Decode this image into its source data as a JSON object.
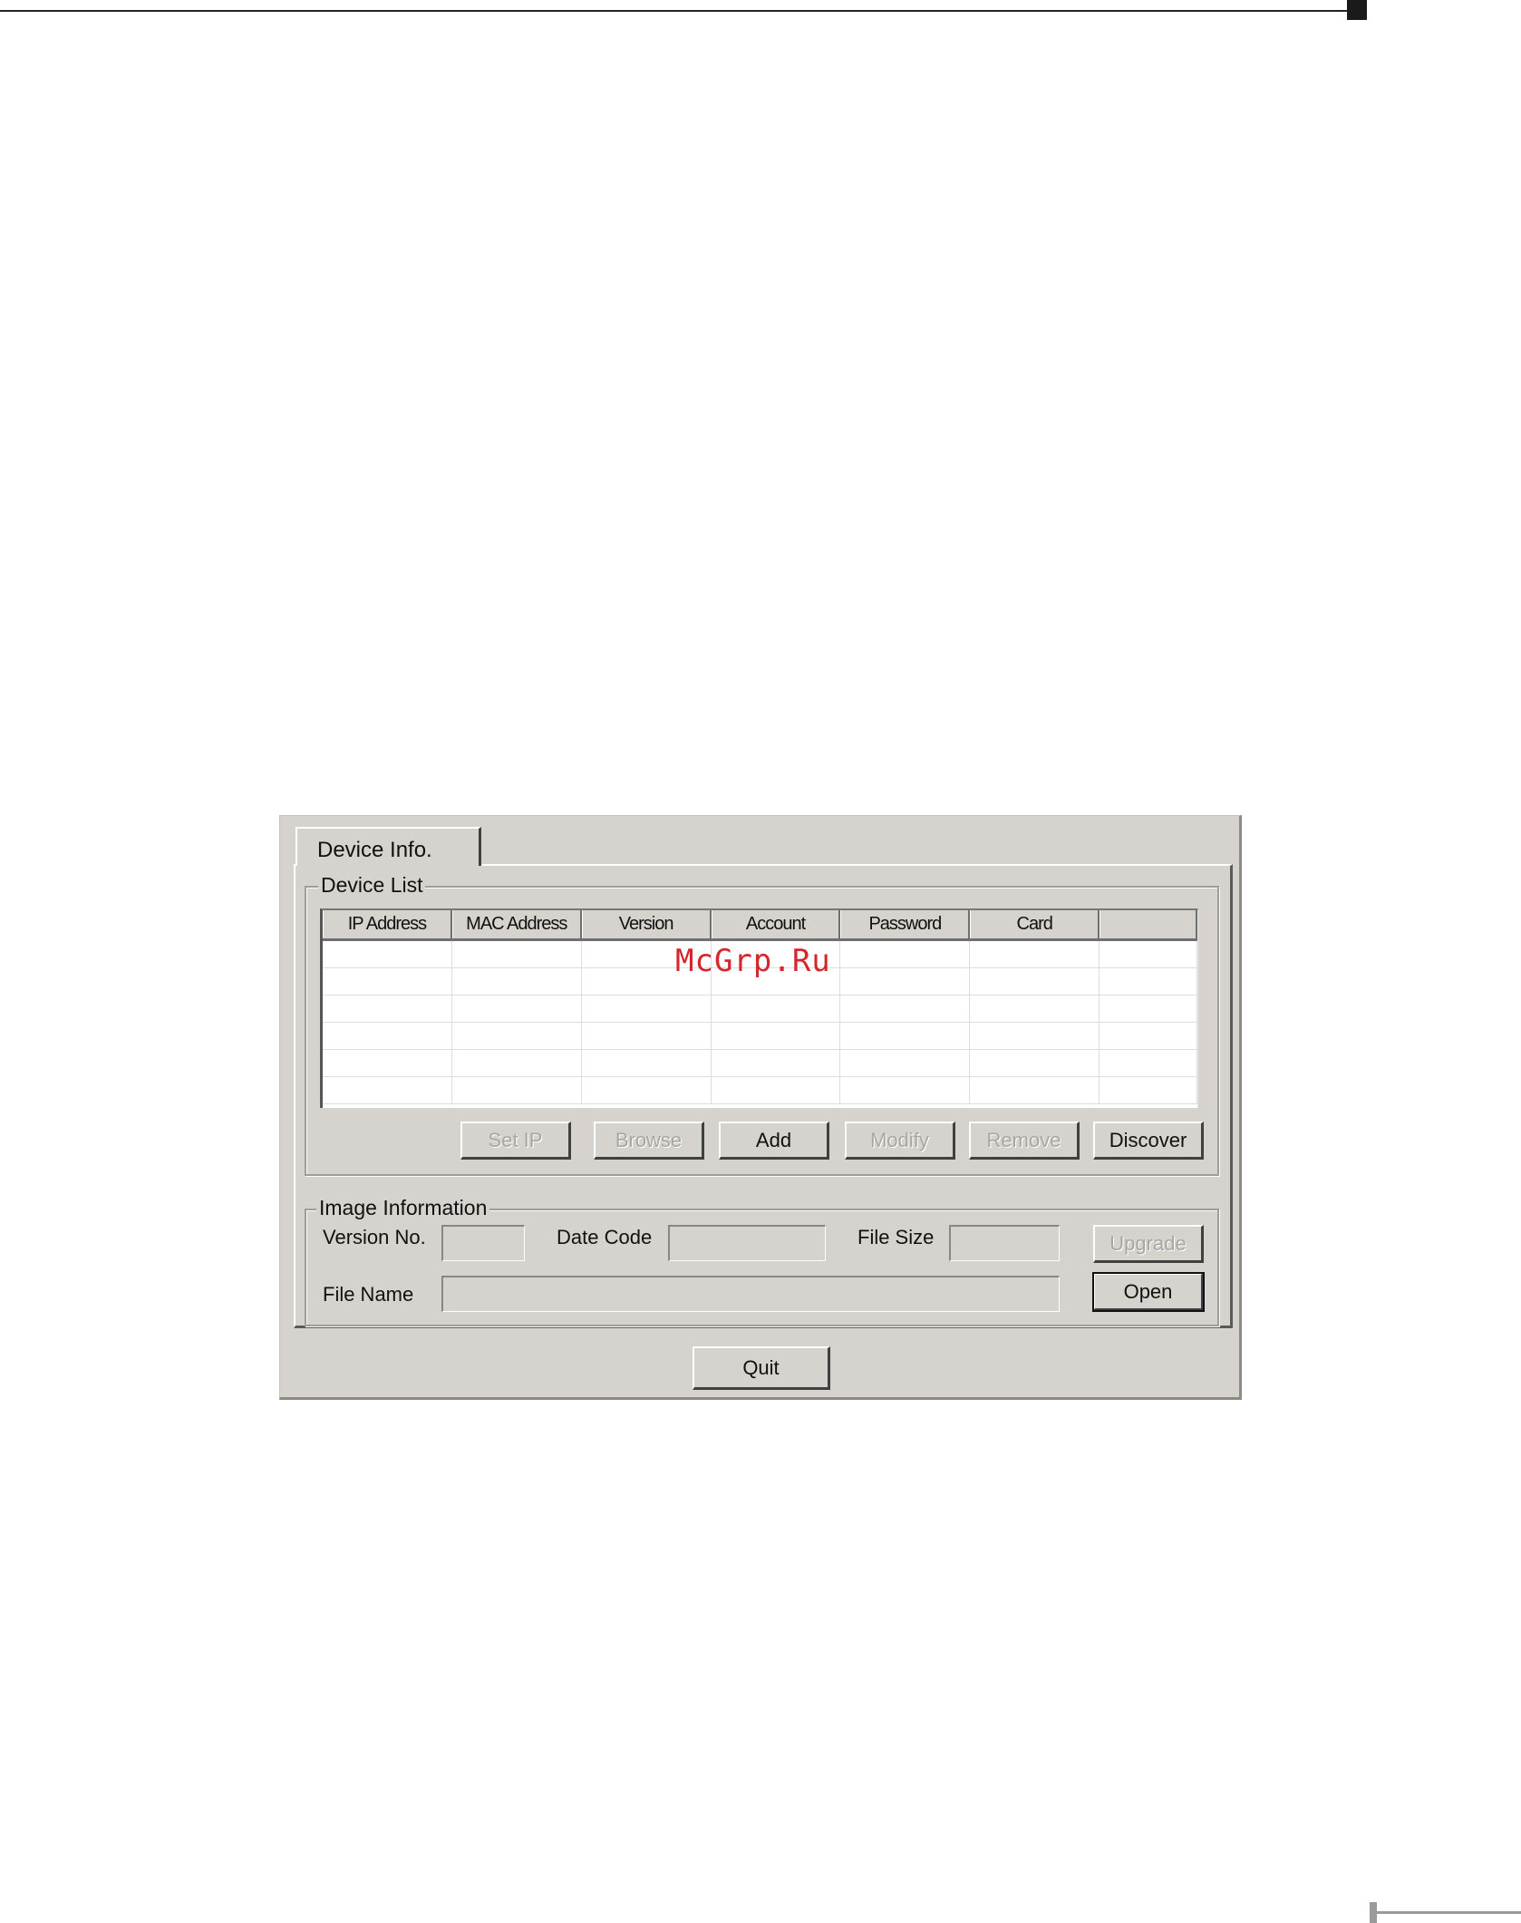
{
  "tab": {
    "label": "Device Info."
  },
  "device_list": {
    "title": "Device List",
    "columns": [
      "IP Address",
      "MAC Address",
      "Version",
      "Account",
      "Password",
      "Card",
      ""
    ],
    "rows": [
      [
        "",
        "",
        "",
        "",
        "",
        "",
        ""
      ],
      [
        "",
        "",
        "",
        "",
        "",
        "",
        ""
      ],
      [
        "",
        "",
        "",
        "",
        "",
        "",
        ""
      ],
      [
        "",
        "",
        "",
        "",
        "",
        "",
        ""
      ],
      [
        "",
        "",
        "",
        "",
        "",
        "",
        ""
      ],
      [
        "",
        "",
        "",
        "",
        "",
        "",
        ""
      ]
    ],
    "buttons": {
      "set_ip": "Set IP",
      "browse": "Browse",
      "add": "Add",
      "modify": "Modify",
      "remove": "Remove",
      "discover": "Discover"
    }
  },
  "image_info": {
    "title": "Image Information",
    "version_label": "Version No.",
    "version_value": "",
    "date_code_label": "Date Code",
    "date_code_value": "",
    "file_size_label": "File Size",
    "file_size_value": "",
    "file_name_label": "File Name",
    "file_name_value": "",
    "upgrade_label": "Upgrade",
    "open_label": "Open"
  },
  "quit_label": "Quit",
  "watermark": "McGrp.Ru"
}
